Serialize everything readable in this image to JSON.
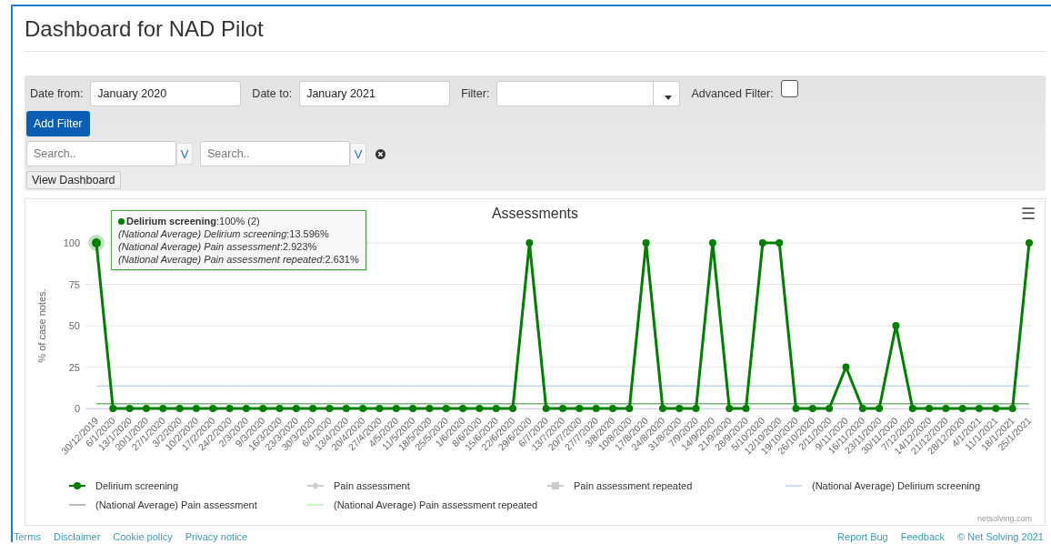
{
  "page": {
    "title": "Dashboard for NAD Pilot"
  },
  "filters": {
    "date_from": {
      "label": "Date from:",
      "value": "January 2020"
    },
    "date_to": {
      "label": "Date to:",
      "value": "January 2021"
    },
    "filter": {
      "label": "Filter:"
    },
    "advanced_filter": {
      "label": "Advanced Filter:",
      "checked": false
    },
    "add_filter_button": "Add Filter",
    "searches": [
      {
        "placeholder": "Search..",
        "toggle": "V"
      },
      {
        "placeholder": "Search..",
        "toggle": "V"
      }
    ],
    "view_button": "View Dashboard"
  },
  "chart": {
    "menu_icon": "☰",
    "credits": "netsolving.com",
    "tooltip": {
      "header": {
        "series": "Delirium screening",
        "value": ":100% (2)",
        "color": "#007f00"
      },
      "lines": [
        "*(National Average) Delirium screening*:13.596%",
        "*(National Average) Pain assessment*:2.923%",
        "*(National Average) Pain assessment repeated*:2.631%"
      ]
    },
    "chart_data": {
      "type": "line",
      "title": "Assessments",
      "grid": true,
      "legend": true,
      "ylabel": "% of case notes.",
      "ylim": [
        0,
        100
      ],
      "yticks": [
        0,
        25,
        50,
        75,
        100
      ],
      "categories": [
        "30/12/2019",
        "6/1/2020",
        "13/1/2020",
        "20/1/2020",
        "27/1/2020",
        "3/2/2020",
        "10/2/2020",
        "17/2/2020",
        "24/2/2020",
        "2/3/2020",
        "9/3/2020",
        "16/3/2020",
        "23/3/2020",
        "30/3/2020",
        "6/4/2020",
        "13/4/2020",
        "20/4/2020",
        "27/4/2020",
        "4/5/2020",
        "11/5/2020",
        "18/5/2020",
        "25/5/2020",
        "1/6/2020",
        "8/6/2020",
        "15/6/2020",
        "22/6/2020",
        "29/6/2020",
        "6/7/2020",
        "13/7/2020",
        "20/7/2020",
        "27/7/2020",
        "3/8/2020",
        "10/8/2020",
        "17/8/2020",
        "24/8/2020",
        "31/8/2020",
        "7/9/2020",
        "14/9/2020",
        "21/9/2020",
        "28/9/2020",
        "5/10/2020",
        "12/10/2020",
        "19/10/2020",
        "26/10/2020",
        "2/11/2020",
        "9/11/2020",
        "16/11/2020",
        "23/11/2020",
        "30/11/2020",
        "7/12/2020",
        "14/12/2020",
        "21/12/2020",
        "28/12/2020",
        "4/1/2021",
        "11/1/2021",
        "18/1/2021",
        "25/1/2021"
      ],
      "series": [
        {
          "name": "Delirium screening",
          "color": "#007f00",
          "marker": "circle",
          "values": [
            100,
            0,
            0,
            0,
            0,
            0,
            0,
            0,
            0,
            0,
            0,
            0,
            0,
            0,
            0,
            0,
            0,
            0,
            0,
            0,
            0,
            0,
            0,
            0,
            0,
            0,
            100,
            0,
            0,
            0,
            0,
            0,
            0,
            100,
            0,
            0,
            0,
            100,
            0,
            0,
            100,
            100,
            0,
            0,
            0,
            25,
            0,
            0,
            50,
            0,
            0,
            0,
            0,
            0,
            0,
            0,
            100
          ]
        },
        {
          "name": "Pain assessment",
          "color": "#cccccc",
          "marker": "diamond",
          "values": [
            null,
            null,
            null,
            null,
            null,
            null,
            null,
            null,
            null,
            null,
            null,
            null,
            null,
            null,
            null,
            null,
            null,
            null,
            null,
            null,
            null,
            null,
            null,
            null,
            null,
            null,
            null,
            null,
            null,
            null,
            null,
            null,
            null,
            null,
            null,
            null,
            null,
            null,
            null,
            null,
            null,
            null,
            null,
            null,
            null,
            null,
            null,
            null,
            null,
            null,
            null,
            null,
            null,
            null,
            null,
            null,
            null
          ]
        },
        {
          "name": "Pain assessment repeated",
          "color": "#cccccc",
          "marker": "square",
          "values": [
            null,
            null,
            null,
            null,
            null,
            null,
            null,
            null,
            null,
            null,
            null,
            null,
            null,
            null,
            null,
            null,
            null,
            null,
            null,
            null,
            null,
            null,
            null,
            null,
            null,
            null,
            null,
            null,
            null,
            null,
            null,
            null,
            null,
            null,
            null,
            null,
            null,
            null,
            null,
            null,
            null,
            null,
            null,
            null,
            null,
            null,
            null,
            null,
            null,
            null,
            null,
            null,
            null,
            null,
            null,
            null,
            null
          ]
        },
        {
          "name": "(National Average) Delirium screening",
          "color": "#9ec3ee",
          "values": [
            13.6,
            13.6,
            13.6,
            13.6,
            13.6,
            13.6,
            13.6,
            13.6,
            13.6,
            13.6,
            13.6,
            13.6,
            13.6,
            13.6,
            13.6,
            13.6,
            13.6,
            13.6,
            13.6,
            13.6,
            13.6,
            13.6,
            13.6,
            13.6,
            13.6,
            13.6,
            13.6,
            13.6,
            13.6,
            13.6,
            13.6,
            13.6,
            13.6,
            13.6,
            13.6,
            13.6,
            13.6,
            13.6,
            13.6,
            13.6,
            13.6,
            13.6,
            13.6,
            13.6,
            13.6,
            13.6,
            13.6,
            13.6,
            13.6,
            13.6,
            13.6,
            13.6,
            13.6,
            13.6,
            13.6,
            13.6,
            13.6
          ]
        },
        {
          "name": "(National Average) Pain assessment",
          "color": "#7a7a7a",
          "values": [
            2.9,
            2.9,
            2.9,
            2.9,
            2.9,
            2.9,
            2.9,
            2.9,
            2.9,
            2.9,
            2.9,
            2.9,
            2.9,
            2.9,
            2.9,
            2.9,
            2.9,
            2.9,
            2.9,
            2.9,
            2.9,
            2.9,
            2.9,
            2.9,
            2.9,
            2.9,
            2.9,
            2.9,
            2.9,
            2.9,
            2.9,
            2.9,
            2.9,
            2.9,
            2.9,
            2.9,
            2.9,
            2.9,
            2.9,
            2.9,
            2.9,
            2.9,
            2.9,
            2.9,
            2.9,
            2.9,
            2.9,
            2.9,
            2.9,
            2.9,
            2.9,
            2.9,
            2.9,
            2.9,
            2.9,
            2.9,
            2.9
          ]
        },
        {
          "name": "(National Average) Pain assessment repeated",
          "color": "#90e890",
          "values": [
            2.6,
            2.6,
            2.6,
            2.6,
            2.6,
            2.6,
            2.6,
            2.6,
            2.6,
            2.6,
            2.6,
            2.6,
            2.6,
            2.6,
            2.6,
            2.6,
            2.6,
            2.6,
            2.6,
            2.6,
            2.6,
            2.6,
            2.6,
            2.6,
            2.6,
            2.6,
            2.6,
            2.6,
            2.6,
            2.6,
            2.6,
            2.6,
            2.6,
            2.6,
            2.6,
            2.6,
            2.6,
            2.6,
            2.6,
            2.6,
            2.6,
            2.6,
            2.6,
            2.6,
            2.6,
            2.6,
            2.6,
            2.6,
            2.6,
            2.6,
            2.6,
            2.6,
            2.6,
            2.6,
            2.6,
            2.6,
            2.6
          ]
        }
      ]
    }
  },
  "footer": {
    "left_links": [
      "Terms",
      "Disclaimer",
      "Cookie policy",
      "Privacy notice"
    ],
    "right_links": [
      "Report Bug",
      "Feedback"
    ],
    "copyright": "© Net Solving 2021"
  }
}
